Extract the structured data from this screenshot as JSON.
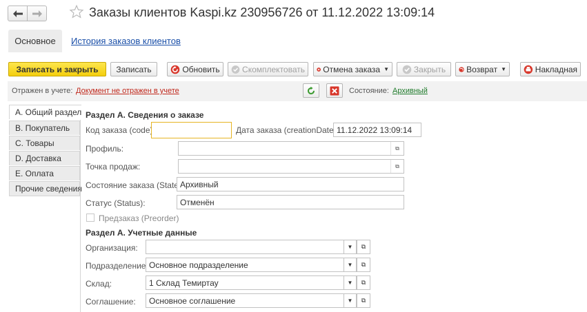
{
  "window": {
    "title": "Заказы клиентов Kaspi.kz 230956726 от 11.12.2022 13:09:14"
  },
  "top_tabs": {
    "main": "Основное",
    "history": "История заказов клиентов"
  },
  "toolbar": {
    "save_close": "Записать и закрыть",
    "save": "Записать",
    "refresh": "Обновить",
    "complete": "Скомплектовать",
    "cancel_order": "Отмена заказа",
    "close": "Закрыть",
    "return": "Возврат",
    "invoice": "Накладная"
  },
  "status_strip": {
    "reflected_label": "Отражен в учете:",
    "reflected_value": "Документ не отражен в учете",
    "state_label": "Состояние:",
    "state_value": "Архивный"
  },
  "side_tabs": [
    "А. Общий раздел",
    "B. Покупатель",
    "C. Товары",
    "D. Доставка",
    "E. Оплата",
    "Прочие сведения"
  ],
  "form": {
    "section_a_info": "Раздел А. Сведения о заказе",
    "order_code_label": "Код заказа (code):",
    "order_code_value": "",
    "order_date_label": "Дата заказа (creationDate):",
    "order_date_value": "11.12.2022 13:09:14",
    "profile_label": "Профиль:",
    "profile_value": "",
    "point_label": "Точка продаж:",
    "point_value": "",
    "order_state_label": "Состояние заказа (State):",
    "order_state_value": "Архивный",
    "status_label": "Статус (Status):",
    "status_value": "Отменён",
    "preorder_label": "Предзаказ (Preorder)",
    "section_a_accounting": "Раздел А. Учетные данные",
    "org_label": "Организация:",
    "org_value": "",
    "division_label": "Подразделение:",
    "division_value": "Основное подразделение",
    "warehouse_label": "Склад:",
    "warehouse_value": "1 Склад Темиртау",
    "agreement_label": "Соглашение:",
    "agreement_value": "Основное соглашение"
  }
}
